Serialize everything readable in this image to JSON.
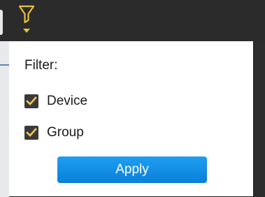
{
  "toolbar": {
    "filter_icon": "funnel-icon",
    "filter_icon_color": "#e7c13a"
  },
  "filter_panel": {
    "title": "Filter:",
    "options": [
      {
        "label": "Device",
        "checked": true
      },
      {
        "label": "Group",
        "checked": true
      }
    ],
    "apply_label": "Apply",
    "apply_color": "#1591e6",
    "checkbox_color": "#3a3a3a",
    "check_color": "#f2c94c"
  }
}
